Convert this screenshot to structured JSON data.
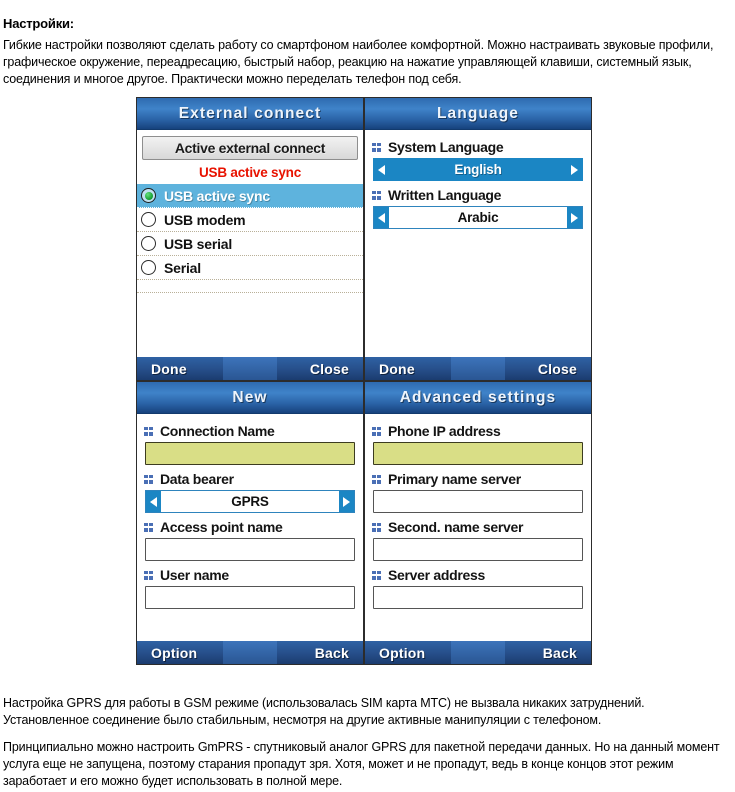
{
  "article": {
    "heading": "Настройки:",
    "intro": "Гибкие настройки позволяют сделать работу со смартфоном наиболее комфортной. Можно настраивать звуковые профили, графическое окружение, переадресацию, быстрый набор, реакцию на нажатие управляющей клавиши, системный язык, соединения и многое другое. Практически можно переделать телефон под себя.",
    "outro1": "Настройка GPRS для работы в GSM режиме (использовалась SIM карта МТС) не вызвала никаких затруднений. Установленное соединение было стабильным, несмотря на другие активные манипуляции с телефоном.",
    "outro2": "Принципиально можно настроить GmPRS - спутниковый аналог GPRS для пакетной передачи данных. Но на данный момент услуга еще не запущена, поэтому старания пропадут зря. Хотя, может и не пропадут, ведь в конце концов этот режим заработает и его можно будет использовать в полной мере."
  },
  "colors": {
    "titlebar_blue": "#2e6bb0",
    "softbar_blue": "#27508c",
    "selection_blue": "#5eb3dd",
    "spinner_blue": "#1b86c4",
    "alert_red": "#e81200",
    "focused_field": "#d9de86",
    "bullet_blue": "#4a6fb5"
  },
  "screens": {
    "external_connect": {
      "title": "External  connect",
      "groupbox_label": "Active external connect",
      "status_text": "USB active sync",
      "options": [
        {
          "label": "USB active sync",
          "selected": true
        },
        {
          "label": "USB modem",
          "selected": false
        },
        {
          "label": "USB serial",
          "selected": false
        },
        {
          "label": "Serial",
          "selected": false
        }
      ],
      "soft_left": "Done",
      "soft_right": "Close"
    },
    "language": {
      "title": "Language",
      "fields": [
        {
          "label": "System Language",
          "value": "English",
          "widget": "spinner",
          "active": true
        },
        {
          "label": "Written Language",
          "value": "Arabic",
          "widget": "spinner",
          "active": false
        }
      ],
      "soft_left": "Done",
      "soft_right": "Close"
    },
    "new_connection": {
      "title": "New",
      "fields": [
        {
          "label": "Connection Name",
          "value": "",
          "widget": "textbox",
          "focused": true
        },
        {
          "label": "Data bearer",
          "value": "GPRS",
          "widget": "spinner",
          "active": false
        },
        {
          "label": "Access point name",
          "value": "",
          "widget": "textbox",
          "focused": false
        },
        {
          "label": "User name",
          "value": "",
          "widget": "textbox",
          "focused": false
        }
      ],
      "soft_left": "Option",
      "soft_right": "Back"
    },
    "advanced_settings": {
      "title": "Advanced  settings",
      "fields": [
        {
          "label": "Phone IP address",
          "value": "",
          "widget": "textbox",
          "focused": true
        },
        {
          "label": "Primary name server",
          "value": "",
          "widget": "textbox",
          "focused": false
        },
        {
          "label": "Second. name server",
          "value": "",
          "widget": "textbox",
          "focused": false
        },
        {
          "label": "Server address",
          "value": "",
          "widget": "textbox",
          "focused": false
        }
      ],
      "soft_left": "Option",
      "soft_right": "Back"
    }
  }
}
